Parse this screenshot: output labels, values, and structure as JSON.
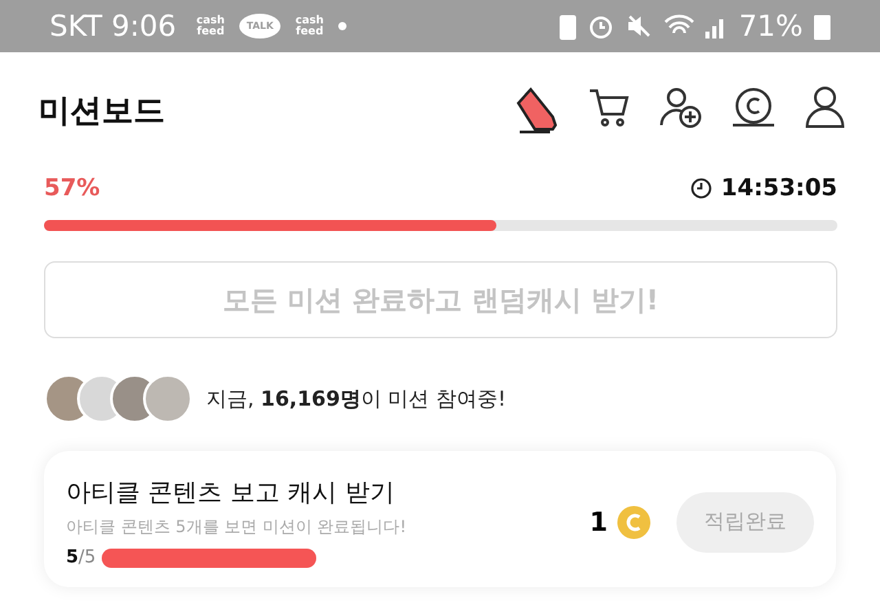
{
  "status_bar": {
    "carrier_time": "SKT 9:06",
    "notifications": [
      "cash feed",
      "TALK",
      "cash feed"
    ],
    "battery": "71%"
  },
  "header": {
    "title": "미션보드"
  },
  "progress": {
    "percent": "57%",
    "level": 0.57,
    "timer": "14:53:05"
  },
  "claim_button": {
    "label": "모든 미션 완료하고 랜덤캐시 받기!",
    "disabled": true
  },
  "participants": {
    "avatars": [
      {
        "kind": "photo"
      },
      {
        "kind": "photo"
      },
      {
        "kind": "photo"
      },
      {
        "kind": "photo"
      }
    ],
    "text": "지금, **16,169명**이 미션 참여중!"
  },
  "missions": [
    {
      "title": "아티클 콘텐츠 보고 캐시 받기",
      "description": "아티클 콘텐츠 5개를 보면 미션이 완료됩니다!",
      "count": "**5**/5",
      "level": 1,
      "reward": "1",
      "button": "적립완료",
      "disabled": true
    }
  ]
}
